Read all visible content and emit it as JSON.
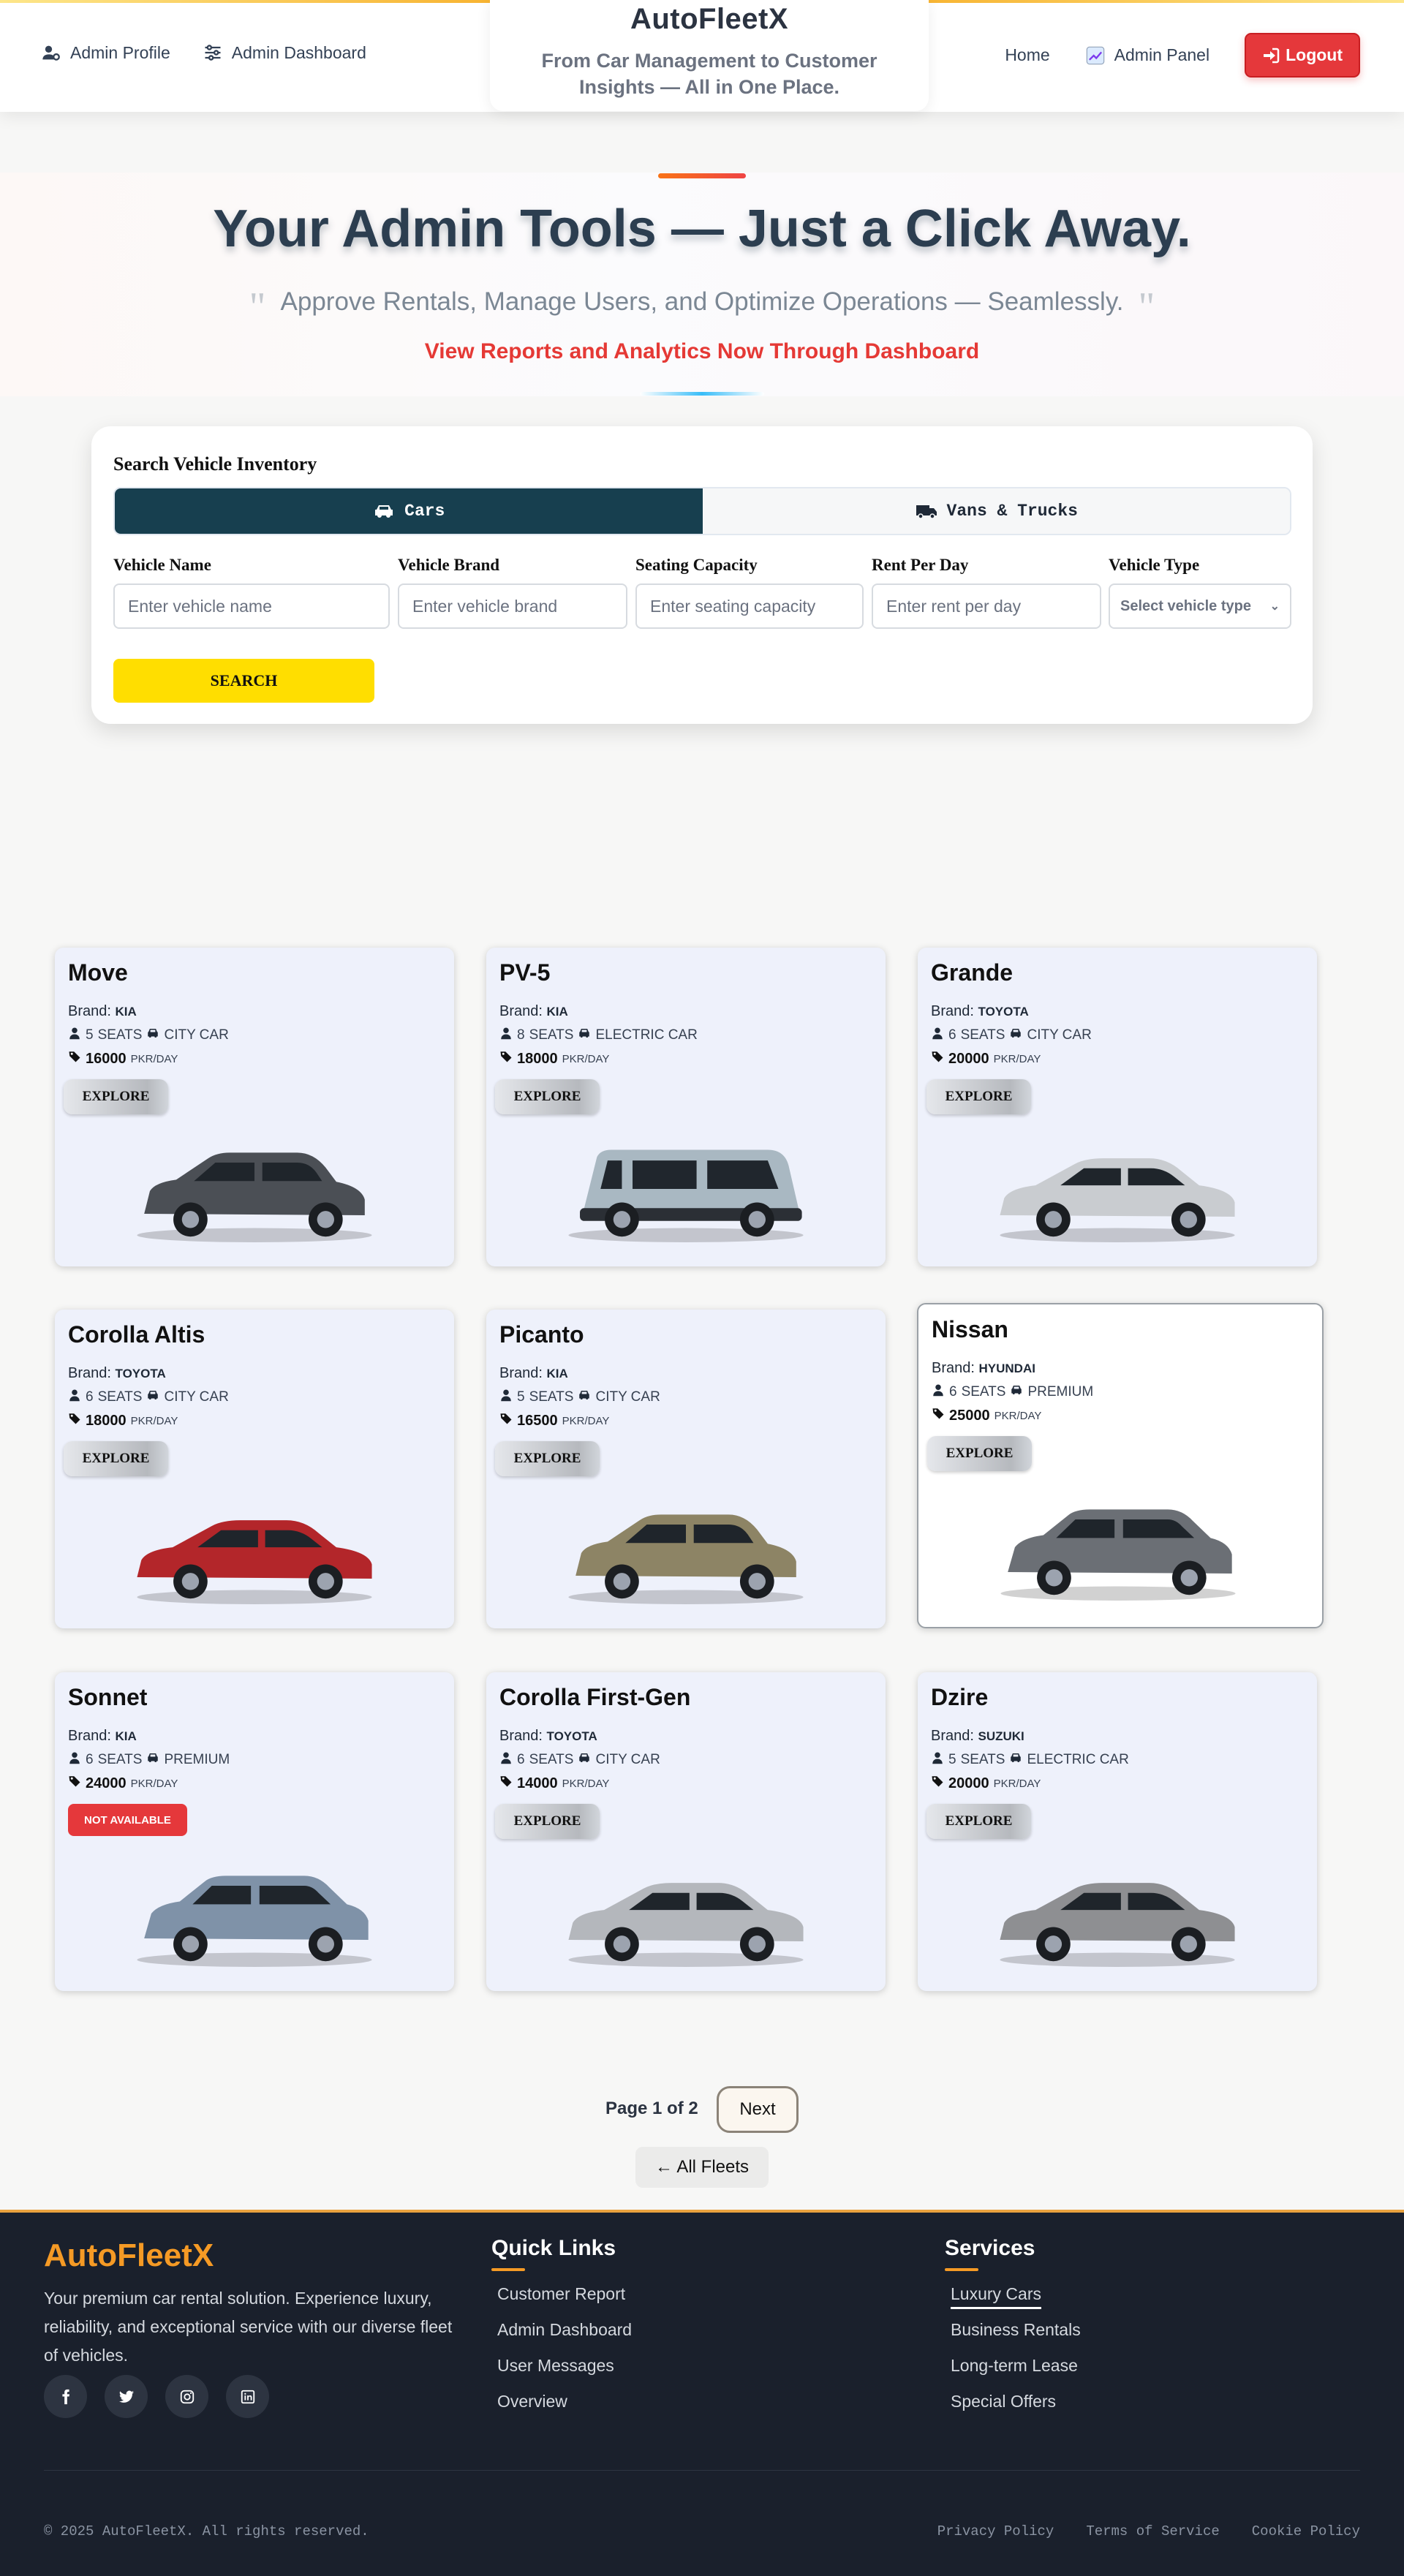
{
  "header": {
    "brand": "AutoFleetX",
    "tagline": "From Car Management to Customer Insights — All in One Place.",
    "nav_left": [
      {
        "label": "Admin Profile",
        "icon": "user-gear-icon"
      },
      {
        "label": "Admin Dashboard",
        "icon": "sliders-icon"
      }
    ],
    "nav_right": [
      {
        "label": "Home"
      },
      {
        "label": "Admin Panel",
        "icon": "chart-icon"
      }
    ],
    "logout_label": "Logout"
  },
  "hero": {
    "title": "Your Admin Tools — Just a Click Away.",
    "quote": "Approve Rentals, Manage Users, and Optimize Operations — Seamlessly.",
    "link": "View Reports and Analytics Now Through Dashboard"
  },
  "search": {
    "heading": "Search Vehicle Inventory",
    "tabs": [
      {
        "label": "Cars",
        "active": true,
        "icon": "car-icon"
      },
      {
        "label": "Vans & Trucks",
        "active": false,
        "icon": "truck-icon"
      }
    ],
    "fields": [
      {
        "label": "Vehicle Name",
        "placeholder": "Enter vehicle name"
      },
      {
        "label": "Vehicle Brand",
        "placeholder": "Enter vehicle brand"
      },
      {
        "label": "Seating Capacity",
        "placeholder": "Enter seating capacity"
      },
      {
        "label": "Rent Per Day",
        "placeholder": "Enter rent per day"
      },
      {
        "label": "Vehicle Type",
        "placeholder": "Select vehicle type"
      }
    ],
    "button": "SEARCH"
  },
  "cards_common": {
    "brand_label": "Brand:",
    "seats_suffix": "SEATS",
    "price_unit": "PKR/DAY",
    "explore": "EXPLORE",
    "not_available": "NOT AVAILABLE"
  },
  "vehicles": [
    {
      "name": "Move",
      "brand": "KIA",
      "seats": "5",
      "type": "CITY CAR",
      "price": "16000",
      "available": true,
      "color": "#4b4f55",
      "shape": "hatch"
    },
    {
      "name": "PV-5",
      "brand": "KIA",
      "seats": "8",
      "type": "ELECTRIC CAR",
      "price": "18000",
      "available": true,
      "color": "#a9b8c2",
      "shape": "van"
    },
    {
      "name": "Grande",
      "brand": "TOYOTA",
      "seats": "6",
      "type": "CITY CAR",
      "price": "20000",
      "available": true,
      "color": "#c9ccd0",
      "shape": "sedan"
    },
    {
      "name": "Corolla Altis",
      "brand": "TOYOTA",
      "seats": "6",
      "type": "CITY CAR",
      "price": "18000",
      "available": true,
      "color": "#b3262a",
      "shape": "sedan"
    },
    {
      "name": "Picanto",
      "brand": "KIA",
      "seats": "5",
      "type": "CITY CAR",
      "price": "16500",
      "available": true,
      "color": "#8d8465",
      "shape": "hatch"
    },
    {
      "name": "Nissan",
      "brand": "HYUNDAI",
      "seats": "6",
      "type": "PREMIUM",
      "price": "25000",
      "available": true,
      "color": "#6b6f75",
      "shape": "suv"
    },
    {
      "name": "Sonnet",
      "brand": "KIA",
      "seats": "6",
      "type": "PREMIUM",
      "price": "24000",
      "available": false,
      "color": "#7f92a8",
      "shape": "suv"
    },
    {
      "name": "Corolla First-Gen",
      "brand": "TOYOTA",
      "seats": "6",
      "type": "CITY CAR",
      "price": "14000",
      "available": true,
      "color": "#b4b7bc",
      "shape": "sedan"
    },
    {
      "name": "Dzire",
      "brand": "SUZUKI",
      "seats": "5",
      "type": "ELECTRIC CAR",
      "price": "20000",
      "available": true,
      "color": "#8e8f92",
      "shape": "sedan"
    }
  ],
  "pagination": {
    "info": "Page 1 of 2",
    "next": "Next",
    "all_fleets": "← All Fleets"
  },
  "footer": {
    "brand": "AutoFleetX",
    "description": "Your premium car rental solution. Experience luxury, reliability, and exceptional service with our diverse fleet of vehicles.",
    "socials": [
      "facebook-icon",
      "twitter-icon",
      "instagram-icon",
      "linkedin-icon"
    ],
    "quick_links": {
      "title": "Quick Links",
      "items": [
        "Customer Report",
        "Admin Dashboard",
        "User Messages",
        "Overview"
      ]
    },
    "services": {
      "title": "Services",
      "items": [
        "Luxury Cars",
        "Business Rentals",
        "Long-term Lease",
        "Special Offers"
      ]
    },
    "copyright": "© 2025 AutoFleetX. All rights reserved.",
    "legal": [
      "Privacy Policy",
      "Terms of Service",
      "Cookie Policy"
    ]
  },
  "colors": {
    "accent_orange": "#f59a25",
    "logout_red": "#e5383b",
    "tab_active": "#173f4f",
    "search_yellow": "#ffde00"
  }
}
